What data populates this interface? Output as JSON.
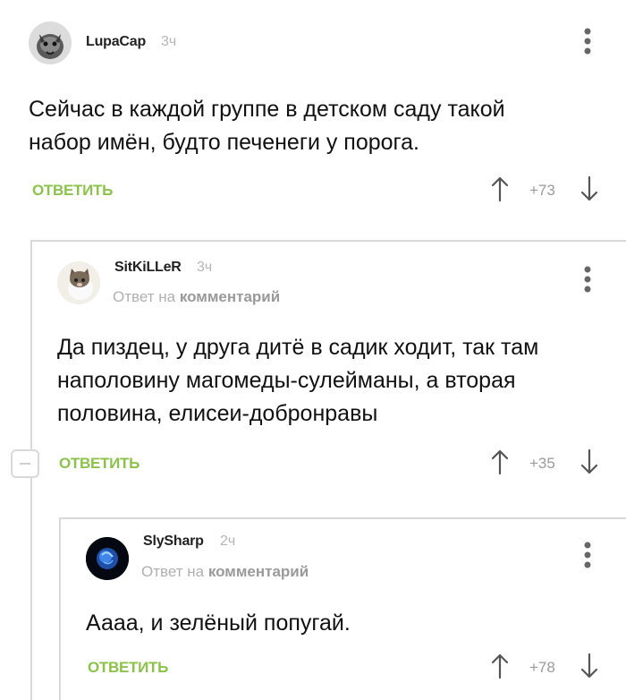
{
  "comments": [
    {
      "username": "LupaCap",
      "time": "3ч",
      "body_line1": "Сейчас в каждой группе в детском саду такой",
      "body_line2": "набор имён, будто печенеги у порога.",
      "reply": "ОТВЕТИТЬ",
      "rating": "+73"
    },
    {
      "username": "SitKiLLeR",
      "time": "3ч",
      "reply_prefix": "Ответ на",
      "reply_target": "комментарий",
      "body_line1": "Да пиздец, у друга дитё в садик ходит, так там",
      "body_line2": "наполовину магомеды-сулейманы, а вторая",
      "body_line3": "половина, елисеи-добронравы",
      "reply": "ОТВЕТИТЬ",
      "rating": "+35"
    },
    {
      "username": "SlySharp",
      "time": "2ч",
      "reply_prefix": "Ответ на",
      "reply_target": "комментарий",
      "body_line1": "Аааа, и зелёный попугай.",
      "reply": "ОТВЕТИТЬ",
      "rating": "+78"
    }
  ],
  "colors": {
    "reply_green": "#8bc34a",
    "muted": "#b5b5b5",
    "thread_line": "#d9d9d9"
  },
  "icons": [
    "avatar-rhino",
    "avatar-cat",
    "avatar-blue-orb",
    "arrow-up-icon",
    "arrow-down-icon",
    "kebab-menu-icon",
    "collapse-minus-icon"
  ]
}
